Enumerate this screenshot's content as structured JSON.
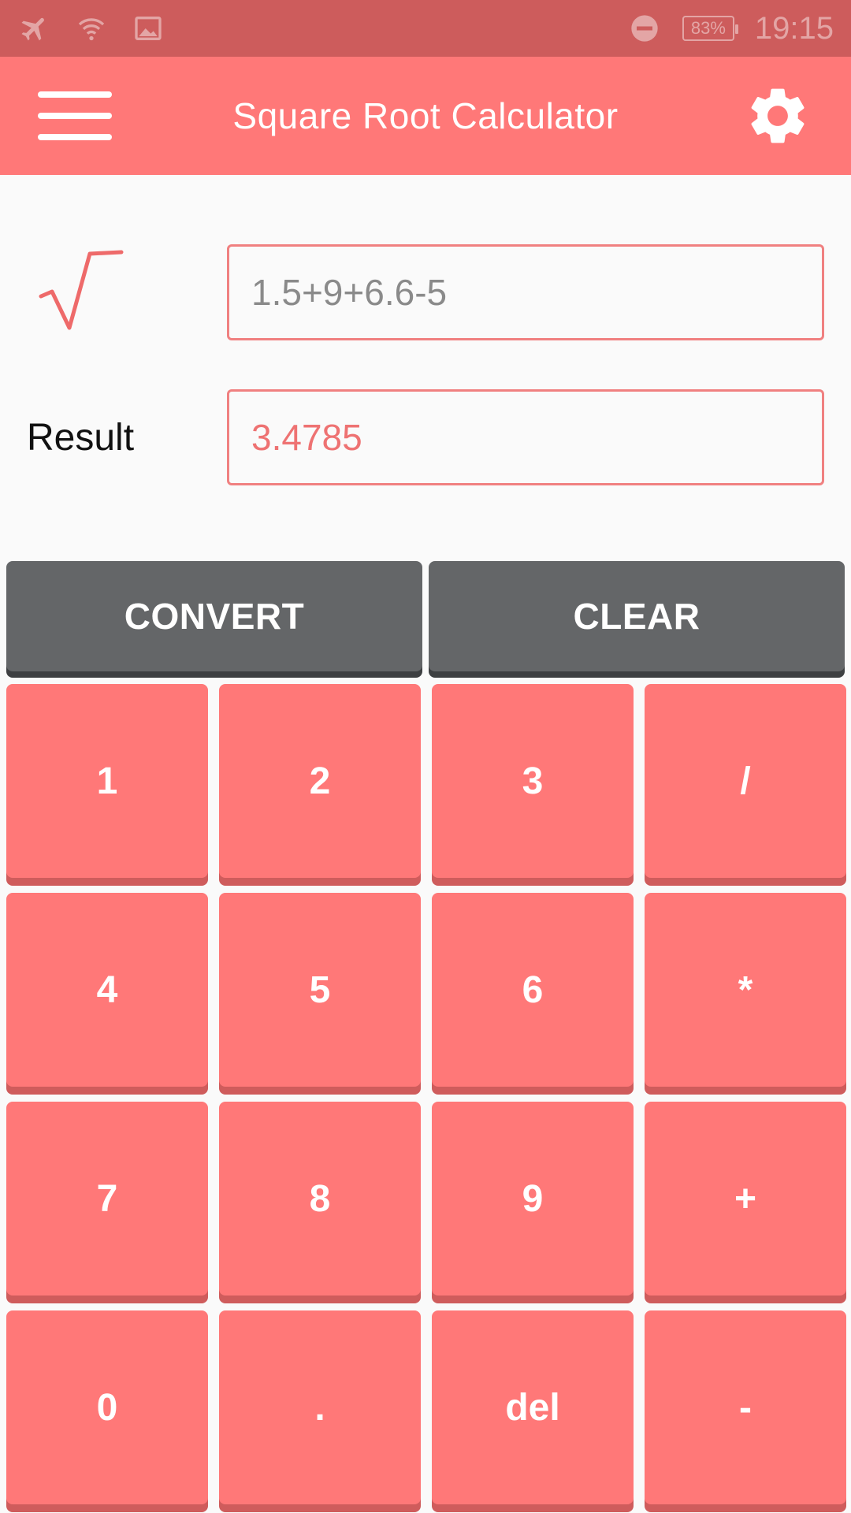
{
  "status_bar": {
    "icons": [
      "airplane-mode-icon",
      "wifi-icon",
      "image-notification-icon",
      "do-not-disturb-icon"
    ],
    "battery": "83%",
    "time": "19:15"
  },
  "app_bar": {
    "title": "Square Root Calculator",
    "menu_icon": "hamburger-menu-icon",
    "settings_icon": "gear-icon"
  },
  "calculator": {
    "sqrt_icon": "square-root-icon",
    "expression": "1.5+9+6.6-5",
    "result_label": "Result",
    "result_value": "3.4785"
  },
  "actions": {
    "convert": "CONVERT",
    "clear": "CLEAR"
  },
  "keypad": [
    [
      "1",
      "2",
      "3",
      "/"
    ],
    [
      "4",
      "5",
      "6",
      "*"
    ],
    [
      "7",
      "8",
      "9",
      "+"
    ],
    [
      "0",
      ".",
      "del",
      "-"
    ]
  ],
  "colors": {
    "status_bar": "#cd5c5c",
    "app_bar": "#ff7878",
    "key": "#ff7878",
    "action_button": "#646668",
    "accent": "#f08080"
  }
}
